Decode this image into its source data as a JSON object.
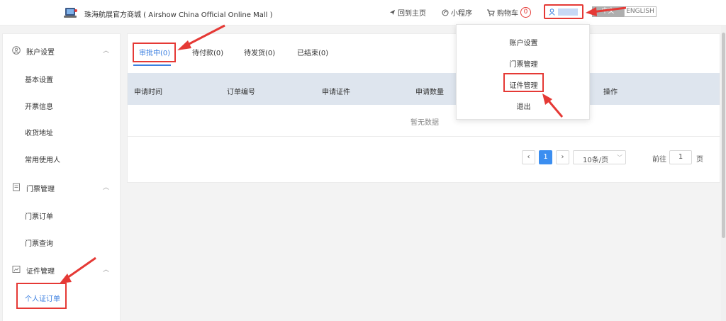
{
  "header": {
    "site_title": "珠海航展官方商城 ( Airshow China Official Online Mall )",
    "nav_home": "回到主页",
    "nav_mini": "小程序",
    "nav_cart": "购物车",
    "cart_count": "0",
    "lang_zh": "中文",
    "lang_en": "ENGLISH"
  },
  "sidebar": {
    "groups": [
      {
        "label": "账户设置",
        "icon": "user-circle-icon",
        "items": [
          "基本设置",
          "开票信息",
          "收货地址",
          "常用使用人"
        ]
      },
      {
        "label": "门票管理",
        "icon": "ticket-doc-icon",
        "items": [
          "门票订单",
          "门票查询"
        ]
      },
      {
        "label": "证件管理",
        "icon": "chart-card-icon",
        "items": [
          "个人证订单"
        ]
      }
    ],
    "active_item": "个人证订单"
  },
  "tabs": [
    {
      "label": "审批中(0)",
      "active": true
    },
    {
      "label": "待付款(0)",
      "active": false
    },
    {
      "label": "待发货(0)",
      "active": false
    },
    {
      "label": "已结束(0)",
      "active": false
    }
  ],
  "table": {
    "columns": [
      "申请时间",
      "订单编号",
      "申请证件",
      "申请数量",
      "操作"
    ],
    "empty_text": "暂无数据"
  },
  "pagination": {
    "prev": "‹",
    "current_page": "1",
    "next": "›",
    "page_size": "10条/页",
    "goto_label": "前往",
    "goto_value": "1",
    "page_suffix": "页"
  },
  "user_menu": {
    "items": [
      "账户设置",
      "门票管理",
      "证件管理",
      "退出"
    ],
    "highlighted": "证件管理"
  },
  "colors": {
    "accent": "#3b7fe0",
    "annotation_red": "#e53935",
    "table_header_bg": "#dee5ee"
  }
}
